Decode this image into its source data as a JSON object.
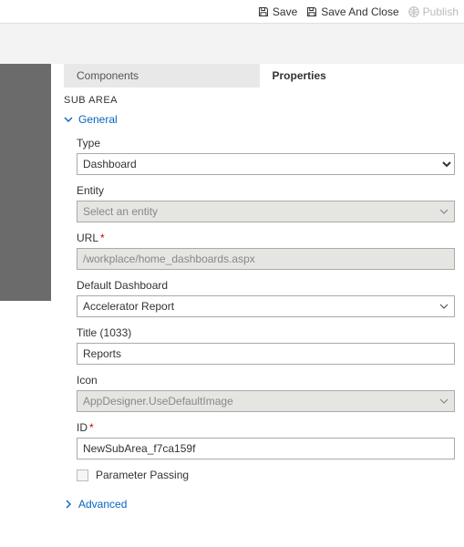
{
  "toolbar": {
    "save": "Save",
    "save_close": "Save And Close",
    "publish": "Publish"
  },
  "tabs": {
    "components": "Components",
    "properties": "Properties"
  },
  "section": "SUB AREA",
  "groups": {
    "general": "General",
    "advanced": "Advanced"
  },
  "fields": {
    "type": {
      "label": "Type",
      "value": "Dashboard"
    },
    "entity": {
      "label": "Entity",
      "placeholder": "Select an entity"
    },
    "url": {
      "label": "URL",
      "value": "/workplace/home_dashboards.aspx",
      "required": true
    },
    "default_dashboard": {
      "label": "Default Dashboard",
      "value": "Accelerator Report"
    },
    "title": {
      "label": "Title (1033)",
      "value": "Reports"
    },
    "icon": {
      "label": "Icon",
      "value": "AppDesigner.UseDefaultImage"
    },
    "id": {
      "label": "ID",
      "value": "NewSubArea_f7ca159f",
      "required": true
    },
    "param_passing": {
      "label": "Parameter Passing",
      "checked": false
    }
  }
}
